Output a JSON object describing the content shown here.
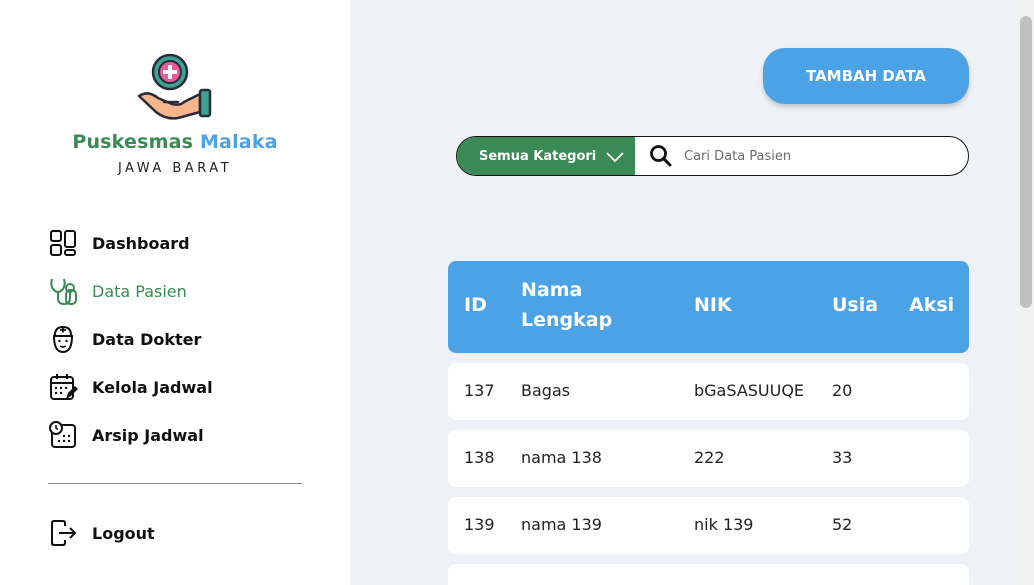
{
  "brand": {
    "name_part1": "Puskesmas",
    "name_part2": "Malaka",
    "subtitle": "JAWA BARAT"
  },
  "sidebar": {
    "items": [
      {
        "label": "Dashboard",
        "icon": "dashboard-grid-icon",
        "active": false
      },
      {
        "label": "Data Pasien",
        "icon": "stethoscope-icon",
        "active": true
      },
      {
        "label": "Data Dokter",
        "icon": "doctor-icon",
        "active": false
      },
      {
        "label": "Kelola Jadwal",
        "icon": "calendar-edit-icon",
        "active": false
      },
      {
        "label": "Arsip Jadwal",
        "icon": "calendar-clock-icon",
        "active": false
      }
    ],
    "logout_label": "Logout"
  },
  "toolbar": {
    "add_label": "TAMBAH DATA"
  },
  "search": {
    "category_value": "Semua Kategori",
    "placeholder": "Cari Data Pasien"
  },
  "table": {
    "headers": {
      "id": "ID",
      "name_line1": "Nama",
      "name_line2": "Lengkap",
      "nik": "NIK",
      "age": "Usia",
      "action": "Aksi"
    },
    "rows": [
      {
        "id": "137",
        "name": "Bagas",
        "nik": "bGaSASUUQE",
        "age": "20"
      },
      {
        "id": "138",
        "name": "nama 138",
        "nik": "222",
        "age": "33"
      },
      {
        "id": "139",
        "name": "nama 139",
        "nik": "nik 139",
        "age": "52"
      }
    ]
  },
  "colors": {
    "green": "#3a8a55",
    "blue": "#4ba3e6",
    "background": "#eef1f6"
  }
}
